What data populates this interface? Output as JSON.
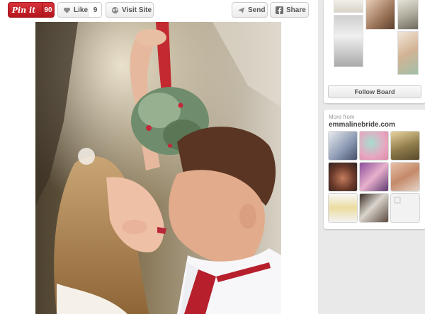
{
  "toolbar": {
    "pinit_label": "Pin it",
    "pinit_count": "90",
    "like_label": "Like",
    "like_count": "9",
    "visit_label": "Visit Site",
    "send_label": "Send",
    "share_label": "Share"
  },
  "board": {
    "follow_label": "Follow Board"
  },
  "more_from": {
    "label": "More from",
    "source": "emmalinebride.com"
  },
  "colors": {
    "pin_red": "#c8232c",
    "page_bg": "#e9e9e9"
  }
}
